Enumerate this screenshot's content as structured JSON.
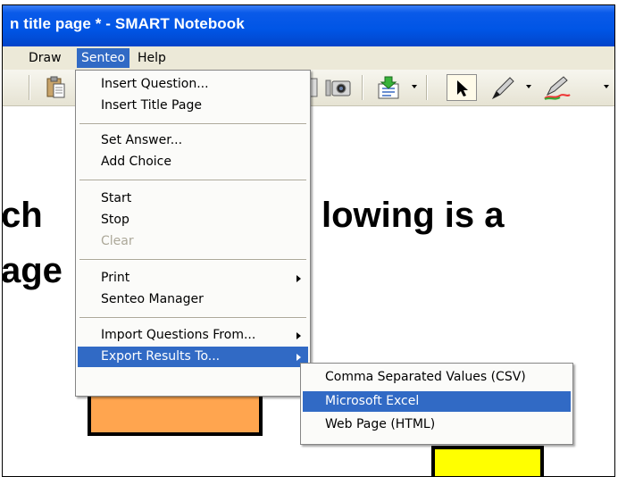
{
  "window": {
    "title": "n title page * - SMART Notebook"
  },
  "menubar": {
    "items": [
      {
        "label": "Draw"
      },
      {
        "label": "Senteo"
      },
      {
        "label": "Help"
      }
    ]
  },
  "canvas": {
    "line1_left": "ch",
    "line1_right": "lowing is a",
    "line2_left": "age"
  },
  "senteo_menu": {
    "items": [
      {
        "label": "Insert Question..."
      },
      {
        "label": "Insert Title Page"
      },
      {
        "label": "Set Answer..."
      },
      {
        "label": "Add Choice"
      },
      {
        "label": "Start"
      },
      {
        "label": "Stop"
      },
      {
        "label": "Clear",
        "disabled": true
      },
      {
        "label": "Print",
        "submenu": true
      },
      {
        "label": "Senteo Manager"
      },
      {
        "label": "Import Questions From...",
        "submenu": true
      },
      {
        "label": "Export Results To...",
        "submenu": true,
        "highlighted": true
      }
    ]
  },
  "export_submenu": {
    "items": [
      {
        "label": "Comma Separated Values (CSV)"
      },
      {
        "label": "Microsoft Excel",
        "highlighted": true
      },
      {
        "label": "Web Page (HTML)"
      }
    ]
  },
  "colors": {
    "titlebar": "#0055e5",
    "menu_highlight": "#316ac5",
    "menubar_bg": "#ece9d8",
    "orange_box": "#ffa54f",
    "yellow_box": "#ffff00"
  }
}
